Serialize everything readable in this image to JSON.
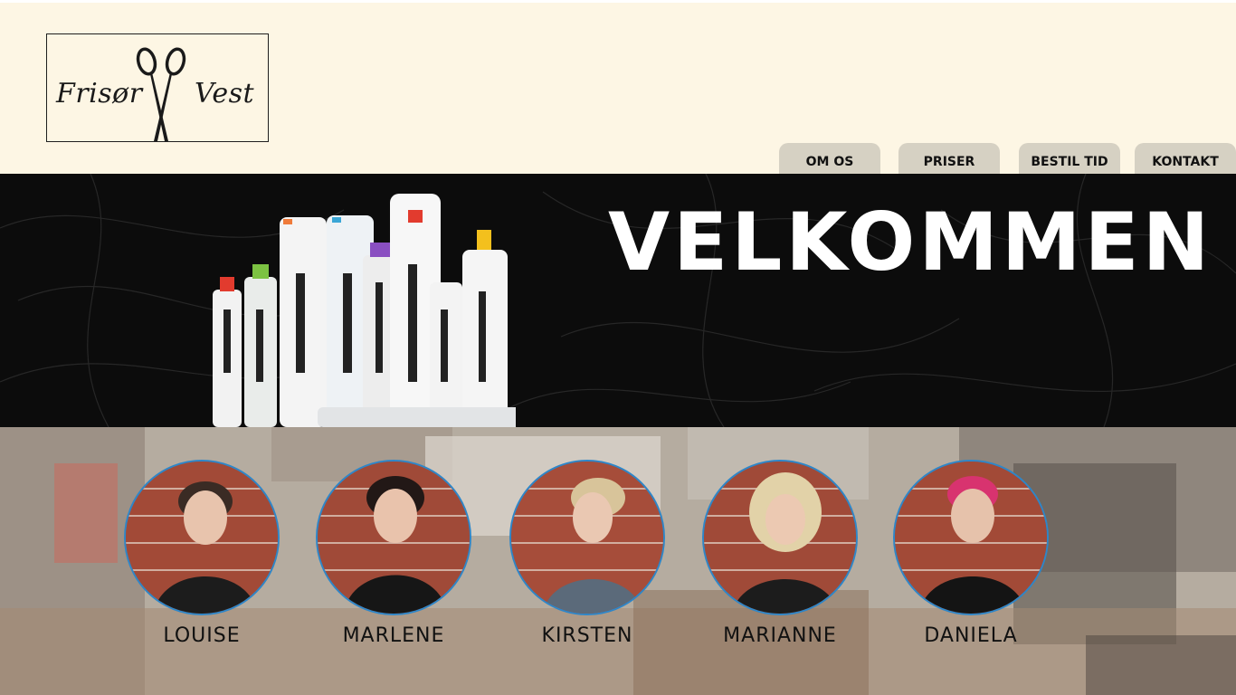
{
  "brand": {
    "name_left": "Frisør",
    "name_right": "Vest"
  },
  "nav": {
    "items": [
      {
        "label": "OM OS"
      },
      {
        "label": "PRISER"
      },
      {
        "label": "BESTIL TID"
      },
      {
        "label": "KONTAKT"
      }
    ]
  },
  "hero": {
    "title": "VELKOMMEN"
  },
  "staff": {
    "members": [
      {
        "name": "LOUISE"
      },
      {
        "name": "MARLENE"
      },
      {
        "name": "KIRSTEN"
      },
      {
        "name": "MARIANNE"
      },
      {
        "name": "DANIELA"
      }
    ]
  },
  "colors": {
    "header_bg": "#fdf6e4",
    "nav_tab": "#d6d1c3",
    "hero_bg": "#0c0c0c",
    "portrait_ring": "#2e86c8"
  }
}
